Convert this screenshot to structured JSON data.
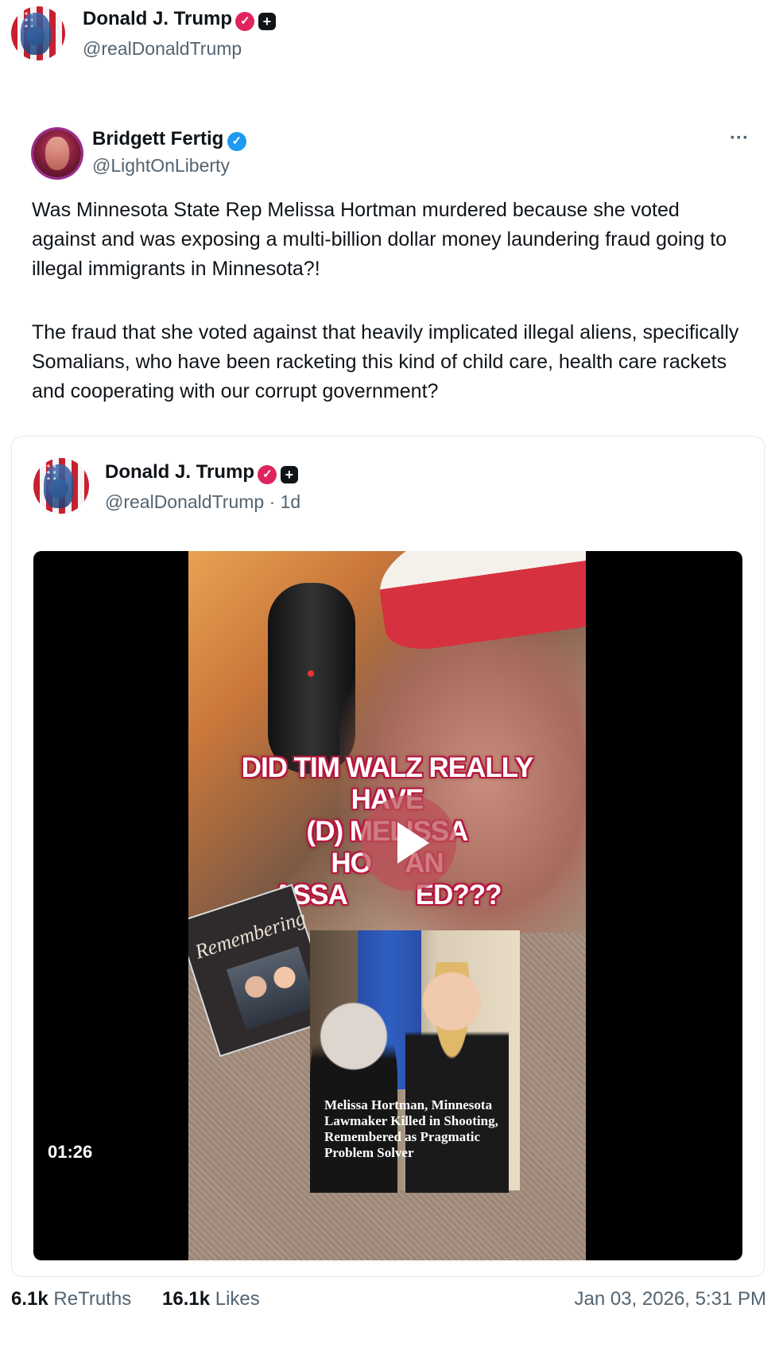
{
  "repost": {
    "author_name": "Donald J. Trump",
    "author_handle": "@realDonaldTrump"
  },
  "quoted_post": {
    "author_name": "Bridgett Fertig",
    "author_handle": "@LightOnLiberty",
    "more_label": "···",
    "paragraph1": "Was Minnesota State Rep Melissa Hortman murdered because she voted against and was exposing a multi-billion dollar money laundering fraud going to illegal immigrants in Minnesota?!",
    "paragraph2": "The fraud that she voted against that heavily implicated illegal aliens, specifically Somalians, who have been racketing this kind of child care, health care rackets and cooperating with our corrupt government?"
  },
  "embedded_post": {
    "author_name": "Donald J. Trump",
    "author_handle": "@realDonaldTrump · 1d",
    "video": {
      "headline_lines": [
        "DID TIM WALZ REALLY",
        "HAVE",
        "(D) MELISSA",
        "HO     AN",
        "ASSA          ED???"
      ],
      "book_title": "Remembering",
      "photo_caption": "Melissa Hortman, Minnesota Lawmaker Killed in Shooting, Remembered as Pragmatic Problem Solver",
      "duration": "01:26"
    }
  },
  "footer": {
    "retruths_count": "6.1k",
    "retruths_label": "ReTruths",
    "likes_count": "16.1k",
    "likes_label": "Likes",
    "timestamp": "Jan 03, 2026, 5:31 PM"
  },
  "colors": {
    "verified_trump": "#e0245e",
    "verified_blue": "#1d9bf0",
    "text_secondary": "#536471"
  }
}
